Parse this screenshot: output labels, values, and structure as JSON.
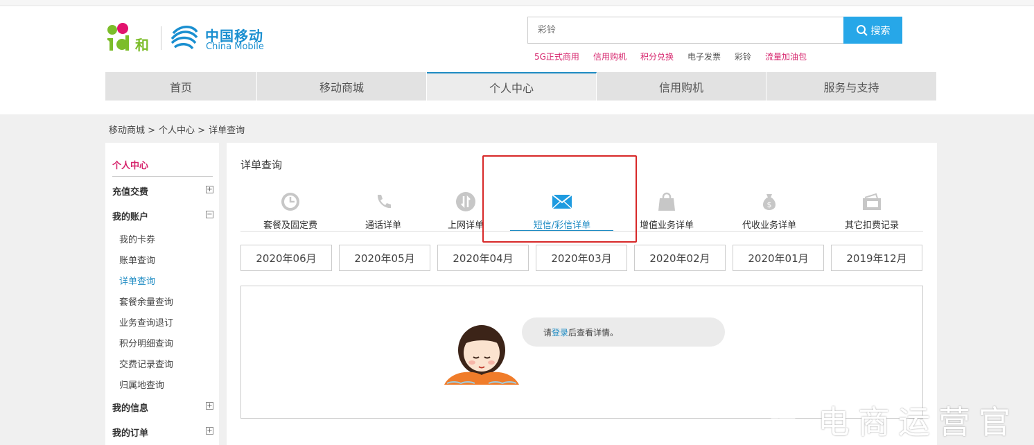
{
  "header": {
    "logo_and": "and和",
    "logo_cn": "中国移动",
    "logo_en": "China Mobile",
    "search_placeholder": "彩铃",
    "search_button": "搜索",
    "hotwords": [
      {
        "label": "5G正式商用",
        "color": "#d6246c"
      },
      {
        "label": "信用购机",
        "color": "#d6246c"
      },
      {
        "label": "积分兑换",
        "color": "#d6246c"
      },
      {
        "label": "电子发票",
        "color": "#555555"
      },
      {
        "label": "彩铃",
        "color": "#555555"
      },
      {
        "label": "流量加油包",
        "color": "#d6246c"
      }
    ]
  },
  "nav": {
    "items": [
      {
        "label": "首页"
      },
      {
        "label": "移动商城"
      },
      {
        "label": "个人中心",
        "active": true
      },
      {
        "label": "信用购机"
      },
      {
        "label": "服务与支持"
      }
    ]
  },
  "breadcrumb": [
    "移动商城 >",
    "个人中心 >",
    "详单查询"
  ],
  "sidebar": {
    "title": "个人中心",
    "groups": [
      {
        "label": "充值交费",
        "toggle": "+"
      },
      {
        "label": "我的账户",
        "toggle": "−"
      },
      {
        "label": "我的信息",
        "toggle": "+"
      },
      {
        "label": "我的订单",
        "toggle": "+"
      }
    ],
    "account_items": [
      "我的卡券",
      "账单查询",
      "详单查询",
      "套餐余量查询",
      "业务查询退订",
      "积分明细查询",
      "交费记录查询",
      "归属地查询"
    ]
  },
  "main": {
    "title": "详单查询",
    "tabs": [
      {
        "label": "套餐及固定费",
        "icon": "clock-icon"
      },
      {
        "label": "通话详单",
        "icon": "phone-icon"
      },
      {
        "label": "上网详单",
        "icon": "data-icon"
      },
      {
        "label": "短信/彩信详单",
        "icon": "envelope-icon",
        "active": true
      },
      {
        "label": "增值业务详单",
        "icon": "bag-icon"
      },
      {
        "label": "代收业务详单",
        "icon": "moneybag-icon"
      },
      {
        "label": "其它扣费记录",
        "icon": "wallet-icon"
      }
    ],
    "months": [
      "2020年06月",
      "2020年05月",
      "2020年04月",
      "2020年03月",
      "2020年02月",
      "2020年01月",
      "2019年12月"
    ],
    "message_prefix": "请",
    "message_login": "登录",
    "message_suffix": "后查看详情。"
  },
  "watermark": "电商运营官",
  "colors": {
    "brand_blue": "#1e8bc3",
    "search_blue": "#27a7e8",
    "accent_pink": "#d6246c",
    "highlight_red": "#d72828"
  }
}
